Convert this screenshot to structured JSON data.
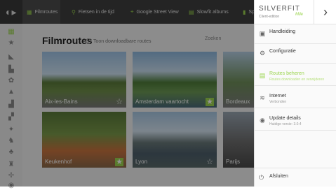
{
  "topbar": {
    "tabs": [
      {
        "label": "Filmroutes",
        "icon": "film-icon",
        "active": true
      },
      {
        "label": "Fietsen in de tijd",
        "icon": "bike-icon",
        "active": false
      },
      {
        "label": "Google Street View",
        "icon": "pin-icon",
        "active": false
      },
      {
        "label": "Slowfit albums",
        "icon": "image-icon",
        "active": false
      },
      {
        "label": "Sp",
        "icon": "bookmark-icon",
        "active": false
      }
    ]
  },
  "main": {
    "title": "Filmroutes",
    "download_toggle_label": "Toon downloadbare routes",
    "search_placeholder": "Zoeken",
    "cards": [
      {
        "label": "Aix-les-Bains",
        "favorite": false
      },
      {
        "label": "Amsterdam vaartocht",
        "favorite": true
      },
      {
        "label": "Bordeaux",
        "favorite": false
      },
      {
        "label": "Keukenhof",
        "favorite": true
      },
      {
        "label": "Lyon",
        "favorite": false
      },
      {
        "label": "Parijs",
        "favorite": false
      }
    ]
  },
  "drawer": {
    "brand": "SILVERFIT",
    "brand_sub": "Client-edition",
    "brand_edition": "Mile",
    "items": [
      {
        "title": "Handleiding",
        "subtitle": "",
        "icon": "manual-icon"
      },
      {
        "title": "Configuratie",
        "subtitle": "",
        "icon": "gear-icon"
      },
      {
        "title": "Routes beheren",
        "subtitle": "Routes downloaden en verwijderen",
        "icon": "routes-icon"
      },
      {
        "title": "Internet",
        "subtitle": "Verbonden",
        "icon": "wifi-icon"
      },
      {
        "title": "Update details",
        "subtitle": "Huidige versie: 3.0.4",
        "icon": "update-icon"
      }
    ],
    "exit_label": "Afsluiten"
  },
  "colors": {
    "accent": "#9bd54f",
    "topbar": "#3e3e3e"
  }
}
